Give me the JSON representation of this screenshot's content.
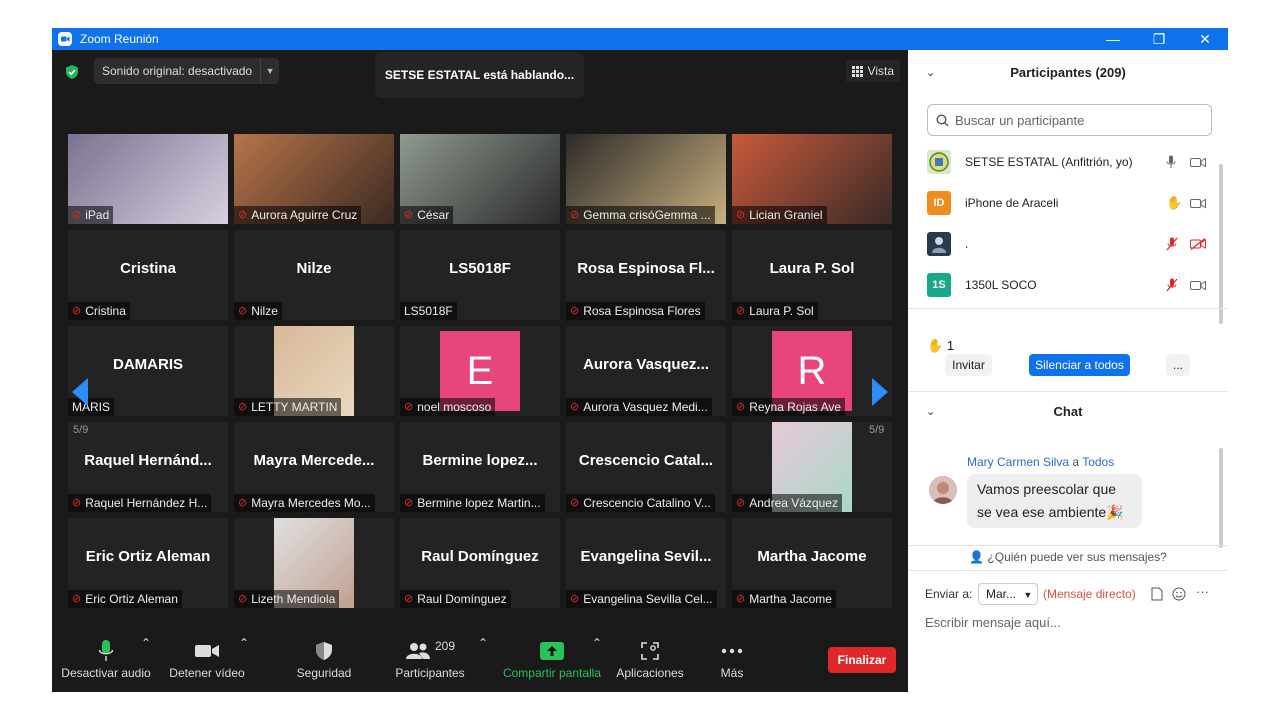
{
  "window": {
    "title": "Zoom Reunión",
    "minimize": "—",
    "restore": "❐",
    "close": "✕"
  },
  "top": {
    "sound_label": "Sonido original: desactivado",
    "speaking": "SETSE ESTATAL está hablando...",
    "view_label": "Vista"
  },
  "pagination": {
    "left": "5/9",
    "right": "5/9"
  },
  "tiles": [
    {
      "label": "iPad",
      "kind": "photo",
      "colors": [
        "#7a7290",
        "#d8d0e0"
      ]
    },
    {
      "label": "Aurora Aguirre Cruz",
      "kind": "photo",
      "colors": [
        "#b7744a",
        "#3b2a22"
      ]
    },
    {
      "label": "César",
      "kind": "photo",
      "colors": [
        "#8f9a90",
        "#2a2a2a"
      ]
    },
    {
      "label": "Gemma crisóGemma ...",
      "kind": "photo",
      "colors": [
        "#2d2a28",
        "#c8b080"
      ]
    },
    {
      "label": "Lician Graniel",
      "kind": "photo",
      "colors": [
        "#c85a3a",
        "#3a2a28"
      ]
    },
    {
      "label": "Cristina",
      "big": "Cristina",
      "kind": "name"
    },
    {
      "label": "Nilze",
      "big": "Nilze",
      "kind": "name"
    },
    {
      "label": "LS5018F",
      "big": "LS5018F",
      "kind": "name",
      "nomic": true
    },
    {
      "label": "Rosa Espinosa Flores",
      "big": "Rosa Espinosa Fl...",
      "kind": "name"
    },
    {
      "label": "Laura P. Sol",
      "big": "Laura P. Sol",
      "kind": "name"
    },
    {
      "label": "MARIS",
      "big": "DAMARIS",
      "kind": "name",
      "nomic": true
    },
    {
      "label": "LETTY MARTIN",
      "kind": "photo",
      "colors": [
        "#d8b898",
        "#e8d8c0"
      ]
    },
    {
      "label": "noel moscoso",
      "kind": "avatar",
      "letter": "E",
      "color": "#e8457a"
    },
    {
      "label": "Aurora Vasquez Medi...",
      "big": "Aurora Vasquez...",
      "kind": "name"
    },
    {
      "label": "Reyna Rojas Ave",
      "kind": "avatar",
      "letter": "R",
      "color": "#e8457a"
    },
    {
      "label": "Raquel Hernández H...",
      "big": "Raquel Hernánd...",
      "kind": "name"
    },
    {
      "label": "Mayra Mercedes Mo...",
      "big": "Mayra Mercede...",
      "kind": "name"
    },
    {
      "label": "Bermine lopez Martin...",
      "big": "Bermine lopez...",
      "kind": "name"
    },
    {
      "label": "Crescencio Catalino V...",
      "big": "Crescencio Catal...",
      "kind": "name"
    },
    {
      "label": "Andrea Vázquez",
      "kind": "photo",
      "colors": [
        "#e8c8d8",
        "#a8d8c8"
      ]
    },
    {
      "label": "Eric Ortiz Aleman",
      "big": "Eric Ortiz Aleman",
      "kind": "name"
    },
    {
      "label": "Lizeth Mendiola",
      "kind": "photo",
      "colors": [
        "#e0e0e0",
        "#c0a090"
      ]
    },
    {
      "label": "Raul Domínguez",
      "big": "Raul Domínguez",
      "kind": "name"
    },
    {
      "label": "Evangelina Sevilla Cel...",
      "big": "Evangelina Sevil...",
      "kind": "name"
    },
    {
      "label": "Martha Jacome",
      "big": "Martha Jacome",
      "kind": "name"
    }
  ],
  "toolbar": {
    "audio": "Desactivar audio",
    "video": "Detener vídeo",
    "security": "Seguridad",
    "participants": "Participantes",
    "participants_count": "209",
    "share": "Compartir pantalla",
    "apps": "Aplicaciones",
    "more": "Más",
    "end": "Finalizar"
  },
  "panel": {
    "participants_title": "Participantes (209)",
    "search_placeholder": "Buscar un participante",
    "participants": [
      {
        "name": "SETSE ESTATAL (Anfitrión, yo)",
        "avatar": "",
        "avatar_color": "#d8e8c8"
      },
      {
        "name": "iPhone de Araceli",
        "avatar": "ID",
        "avatar_color": "#f08c1e"
      },
      {
        "name": ".",
        "avatar": "",
        "avatar_color": "#2a3a4a"
      },
      {
        "name": "1350L SOCO",
        "avatar": "1S",
        "avatar_color": "#1aa88a"
      }
    ],
    "raised_count": "1",
    "invite": "Invitar",
    "mute_all": "Silenciar a todos",
    "more": "...",
    "chat_title": "Chat",
    "chat": {
      "from": "Mary Carmen Silva",
      "connector": "a",
      "to": "Todos",
      "message_line1": "Vamos preescolar que",
      "message_line2": "se vea ese ambiente",
      "who_can_see": "¿Quién puede ver sus mensajes?",
      "send_to_label": "Enviar a:",
      "send_to_value": "Mar...",
      "direct": "(Mensaje directo)",
      "input_placeholder": "Escribir mensaje aquí..."
    }
  }
}
